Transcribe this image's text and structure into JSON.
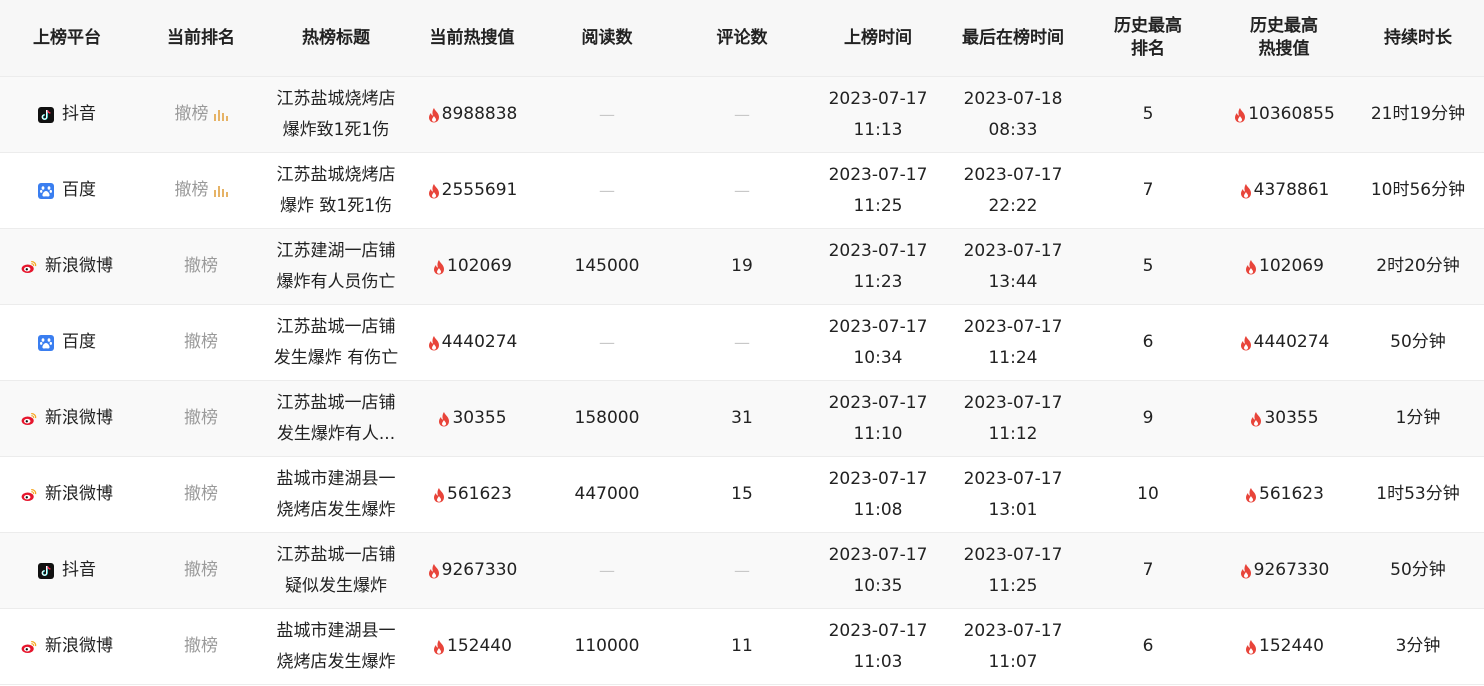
{
  "headers": [
    "上榜平台",
    "当前排名",
    "热榜标题",
    "当前热搜值",
    "阅读数",
    "评论数",
    "上榜时间",
    "最后在榜时间",
    "历史最高\n排名",
    "历史最高\n热搜值",
    "持续时长"
  ],
  "colors": {
    "fire": "#e8443a",
    "muted": "#9a9a9a",
    "dash": "#c8c8c8",
    "rank_bar": "#e6b366"
  },
  "rows": [
    {
      "platform": "抖音",
      "platform_icon": "douyin-icon",
      "rank": "撤榜",
      "rank_chart": true,
      "title": [
        "江苏盐城烧烤店",
        "爆炸致1死1伤"
      ],
      "hot": "8988838",
      "reads": "—",
      "comments": "—",
      "on_date": "2023-07-17",
      "on_time": "11:13",
      "last_date": "2023-07-18",
      "last_time": "08:33",
      "best_rank": "5",
      "best_hot": "10360855",
      "duration": "21时19分钟"
    },
    {
      "platform": "百度",
      "platform_icon": "baidu-icon",
      "rank": "撤榜",
      "rank_chart": true,
      "title": [
        "江苏盐城烧烤店",
        "爆炸 致1死1伤"
      ],
      "hot": "2555691",
      "reads": "—",
      "comments": "—",
      "on_date": "2023-07-17",
      "on_time": "11:25",
      "last_date": "2023-07-17",
      "last_time": "22:22",
      "best_rank": "7",
      "best_hot": "4378861",
      "duration": "10时56分钟"
    },
    {
      "platform": "新浪微博",
      "platform_icon": "weibo-icon",
      "rank": "撤榜",
      "rank_chart": false,
      "title": [
        "江苏建湖一店铺",
        "爆炸有人员伤亡"
      ],
      "hot": "102069",
      "reads": "145000",
      "comments": "19",
      "on_date": "2023-07-17",
      "on_time": "11:23",
      "last_date": "2023-07-17",
      "last_time": "13:44",
      "best_rank": "5",
      "best_hot": "102069",
      "duration": "2时20分钟"
    },
    {
      "platform": "百度",
      "platform_icon": "baidu-icon",
      "rank": "撤榜",
      "rank_chart": false,
      "title": [
        "江苏盐城一店铺",
        "发生爆炸 有伤亡"
      ],
      "hot": "4440274",
      "reads": "—",
      "comments": "—",
      "on_date": "2023-07-17",
      "on_time": "10:34",
      "last_date": "2023-07-17",
      "last_time": "11:24",
      "best_rank": "6",
      "best_hot": "4440274",
      "duration": "50分钟"
    },
    {
      "platform": "新浪微博",
      "platform_icon": "weibo-icon",
      "rank": "撤榜",
      "rank_chart": false,
      "title": [
        "江苏盐城一店铺",
        "发生爆炸有人..."
      ],
      "hot": "30355",
      "reads": "158000",
      "comments": "31",
      "on_date": "2023-07-17",
      "on_time": "11:10",
      "last_date": "2023-07-17",
      "last_time": "11:12",
      "best_rank": "9",
      "best_hot": "30355",
      "duration": "1分钟"
    },
    {
      "platform": "新浪微博",
      "platform_icon": "weibo-icon",
      "rank": "撤榜",
      "rank_chart": false,
      "title": [
        "盐城市建湖县一",
        "烧烤店发生爆炸"
      ],
      "hot": "561623",
      "reads": "447000",
      "comments": "15",
      "on_date": "2023-07-17",
      "on_time": "11:08",
      "last_date": "2023-07-17",
      "last_time": "13:01",
      "best_rank": "10",
      "best_hot": "561623",
      "duration": "1时53分钟"
    },
    {
      "platform": "抖音",
      "platform_icon": "douyin-icon",
      "rank": "撤榜",
      "rank_chart": false,
      "title": [
        "江苏盐城一店铺",
        "疑似发生爆炸"
      ],
      "hot": "9267330",
      "reads": "—",
      "comments": "—",
      "on_date": "2023-07-17",
      "on_time": "10:35",
      "last_date": "2023-07-17",
      "last_time": "11:25",
      "best_rank": "7",
      "best_hot": "9267330",
      "duration": "50分钟"
    },
    {
      "platform": "新浪微博",
      "platform_icon": "weibo-icon",
      "rank": "撤榜",
      "rank_chart": false,
      "title": [
        "盐城市建湖县一",
        "烧烤店发生爆炸"
      ],
      "hot": "152440",
      "reads": "110000",
      "comments": "11",
      "on_date": "2023-07-17",
      "on_time": "11:03",
      "last_date": "2023-07-17",
      "last_time": "11:07",
      "best_rank": "6",
      "best_hot": "152440",
      "duration": "3分钟"
    }
  ]
}
